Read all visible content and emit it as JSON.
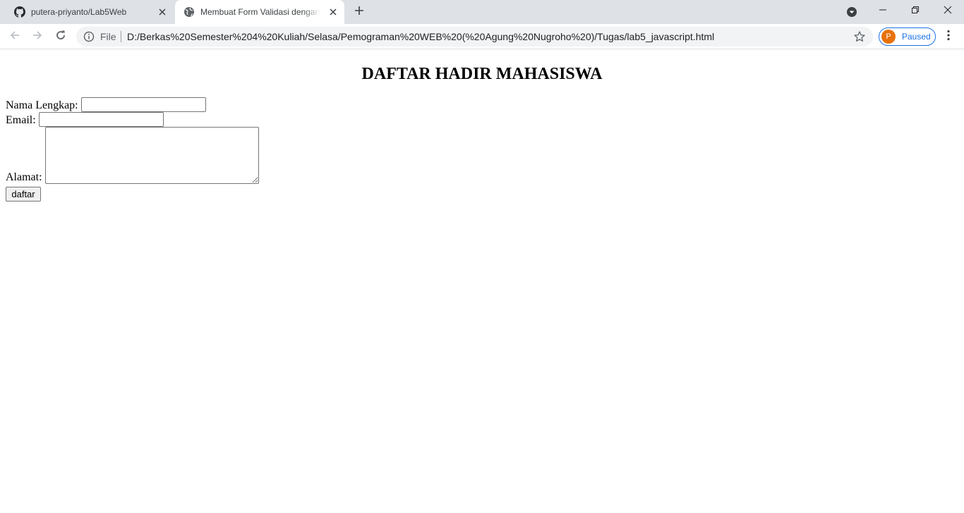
{
  "browser": {
    "tabs": [
      {
        "title": "putera-priyanto/Lab5Web",
        "icon": "github-icon",
        "active": false
      },
      {
        "title": "Membuat Form Validasi dengan J",
        "icon": "globe-icon",
        "active": true
      }
    ],
    "new_tab_icon": "plus-icon",
    "omnibox": {
      "scheme_label": "File",
      "url": "D:/Berkas%20Semester%204%20Kuliah/Selasa/Pemograman%20WEB%20(%20Agung%20Nugroho%20)/Tugas/lab5_javascript.html"
    },
    "profile": {
      "initial": "P",
      "status": "Paused",
      "color": "#e8710a"
    },
    "accent": "#1a73e8"
  },
  "page": {
    "title": "DAFTAR HADIR MAHASISWA",
    "form": {
      "nama_label": "Nama Lengkap:",
      "nama_value": "",
      "email_label": "Email:",
      "email_value": "",
      "alamat_label": "Alamat:",
      "alamat_value": "",
      "submit_label": "daftar"
    }
  }
}
